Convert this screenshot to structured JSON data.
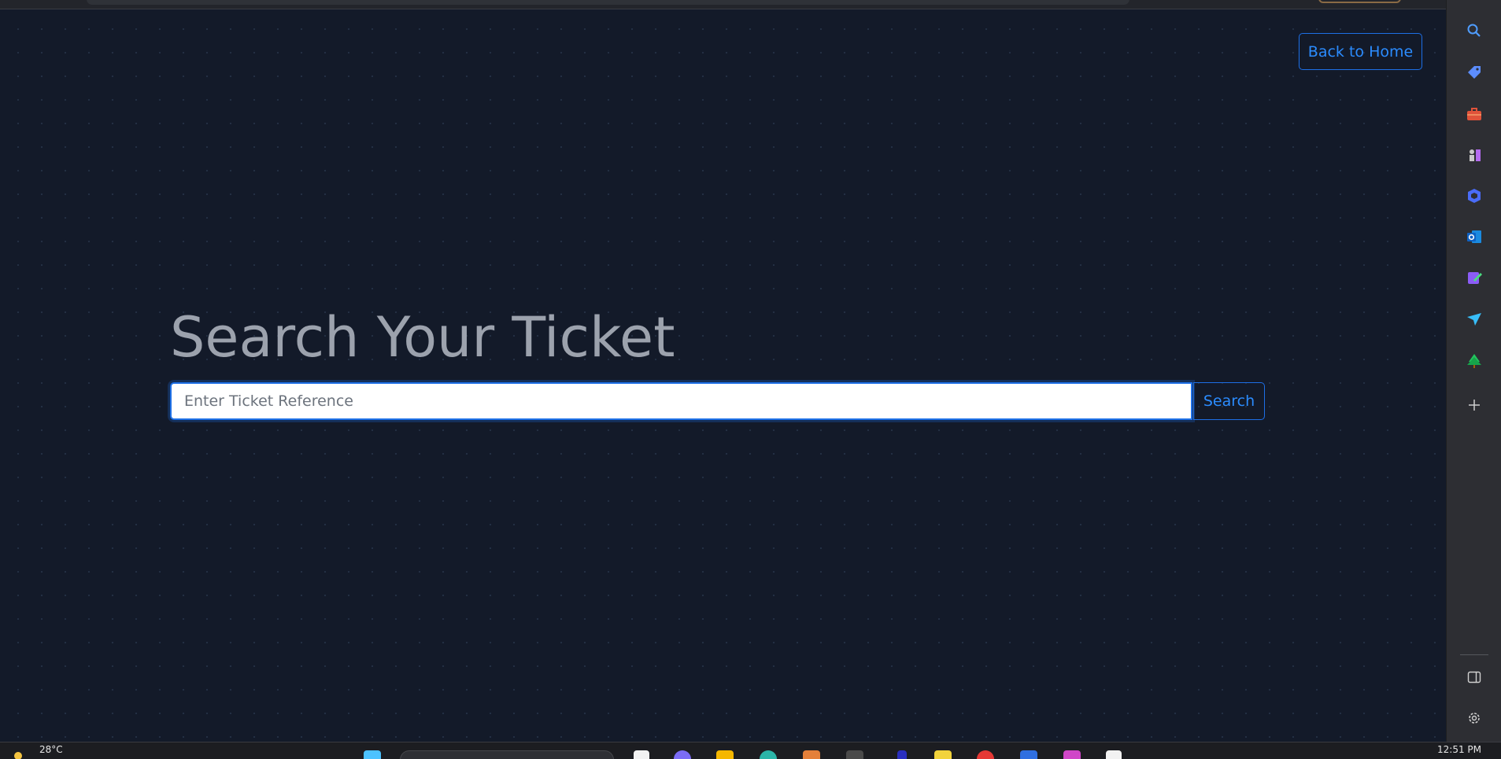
{
  "page": {
    "back_label": "Back to Home",
    "title": "Search Your Ticket",
    "search_placeholder": "Enter Ticket Reference",
    "search_button": "Search"
  },
  "sidebar": {
    "icons": [
      "search-icon",
      "tag-icon",
      "toolbox-icon",
      "chess-icon",
      "copilot-icon",
      "outlook-icon",
      "designer-icon",
      "send-icon",
      "tree-icon",
      "add-icon",
      "sidebar-toggle-icon",
      "settings-icon"
    ]
  },
  "taskbar": {
    "temperature": "28°C",
    "time": "12:51 PM"
  },
  "colors": {
    "background": "#131a29",
    "accent": "#1d6fe6",
    "title": "#9ca2ad"
  }
}
